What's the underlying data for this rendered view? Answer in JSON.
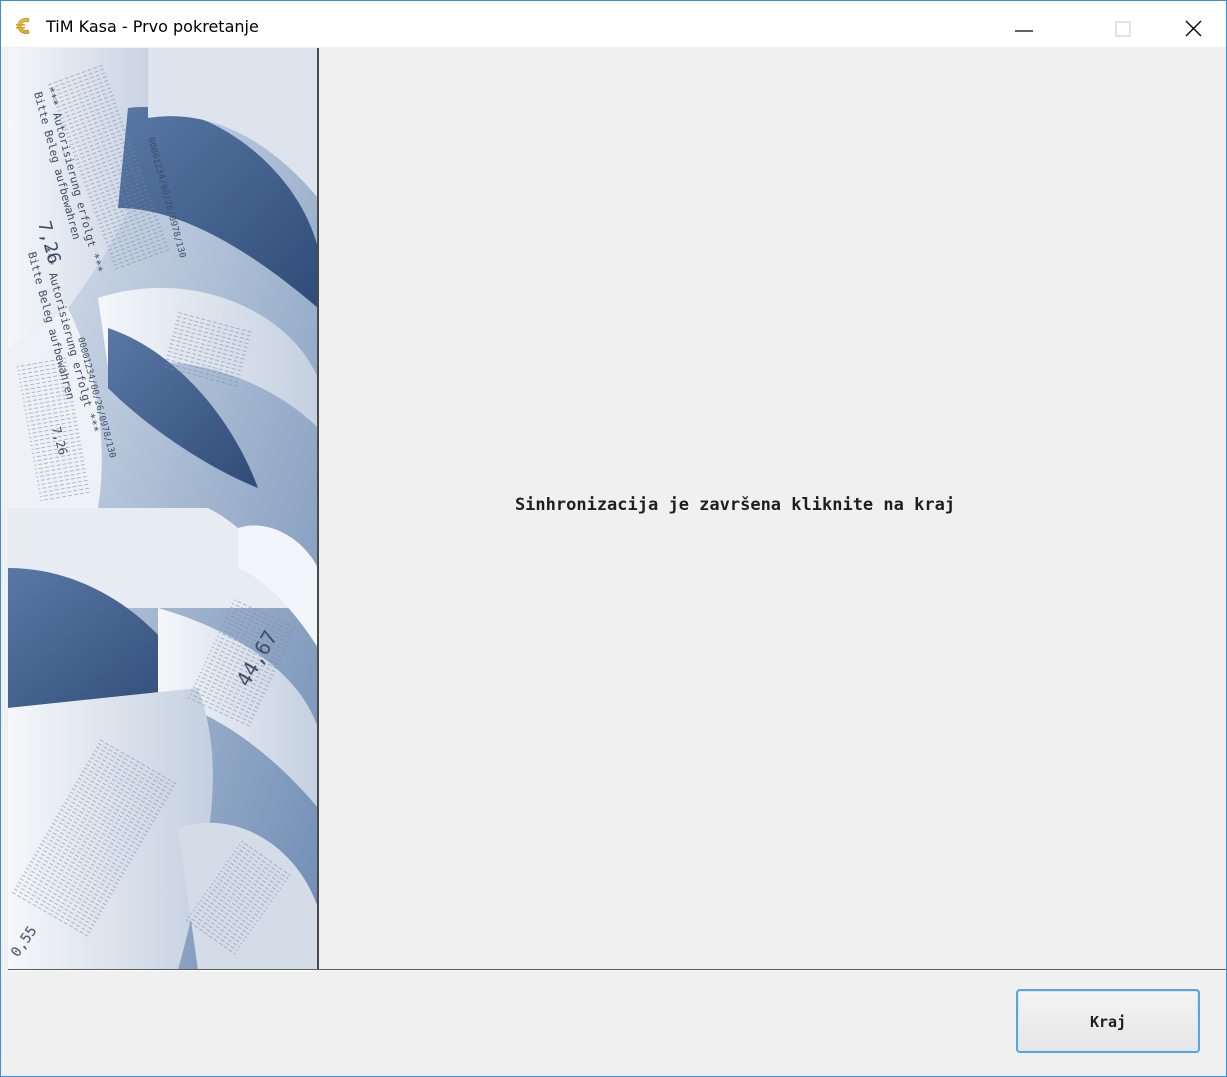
{
  "window": {
    "title": "TiM Kasa - Prvo pokretanje",
    "icon": "euro-coin-icon",
    "controls": {
      "minimize_icon": "minimize-icon",
      "maximize_icon": "maximize-icon",
      "close_icon": "close-icon"
    }
  },
  "side_panel": {
    "image": "receipt-rolls-image",
    "receipt_text": {
      "line1": "*** Autorisierung erfolgt ***",
      "line2": "Bitte Beleg aufbewahren",
      "amount1": "7,26",
      "code": "00001234/00/26/0978/130",
      "amount2": "44,67",
      "amount3": "0,55"
    }
  },
  "main": {
    "message": "Sinhronizacija je završena kliknite na kraj"
  },
  "footer": {
    "kraj_label": "Kraj"
  },
  "colors": {
    "window_border": "#3a8fd6",
    "background": "#f0f0f0",
    "button_border": "#5aa5dc",
    "image_tint": "#7f98bd"
  }
}
